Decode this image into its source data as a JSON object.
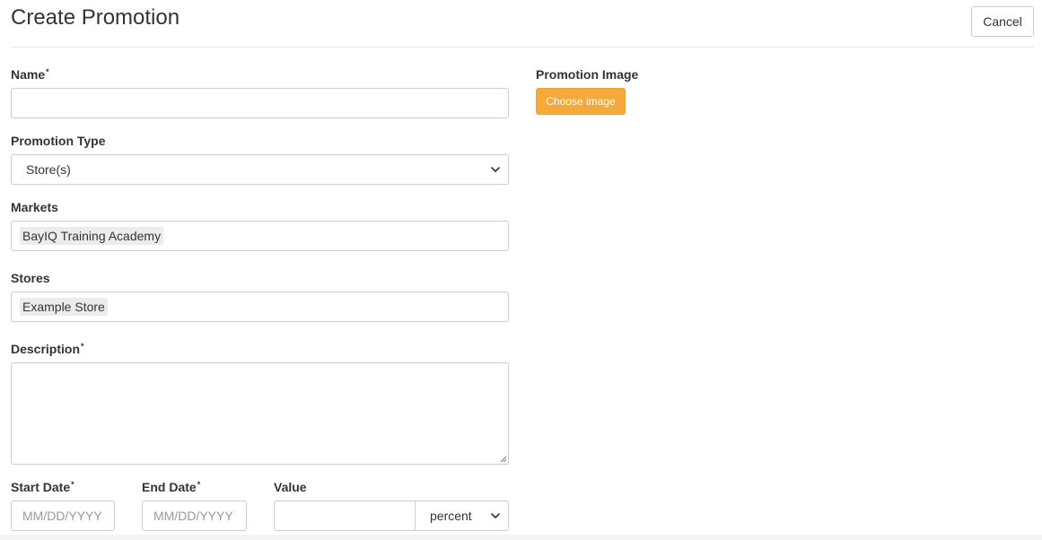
{
  "header": {
    "title": "Create Promotion",
    "cancel_label": "Cancel"
  },
  "form": {
    "name": {
      "label": "Name",
      "required": "*",
      "value": ""
    },
    "promotion_type": {
      "label": "Promotion Type",
      "selected": "Store(s)"
    },
    "markets": {
      "label": "Markets",
      "tags": [
        "BayIQ Training Academy"
      ]
    },
    "stores": {
      "label": "Stores",
      "tags": [
        "Example Store"
      ]
    },
    "description": {
      "label": "Description",
      "required": "*",
      "value": ""
    },
    "start_date": {
      "label": "Start Date",
      "required": "*",
      "placeholder": "MM/DD/YYYY"
    },
    "end_date": {
      "label": "End Date",
      "required": "*",
      "placeholder": "MM/DD/YYYY"
    },
    "value": {
      "label": "Value",
      "input_value": "",
      "unit_selected": "percent"
    }
  },
  "image": {
    "label": "Promotion Image",
    "button_label": "Choose image"
  },
  "icons": {
    "select_arrow": "chevron-down-icon",
    "textarea_grip": "resize-grip-icon"
  },
  "colors": {
    "choose_button": "#f6a93b",
    "text": "#333333",
    "border": "#cccccc"
  }
}
